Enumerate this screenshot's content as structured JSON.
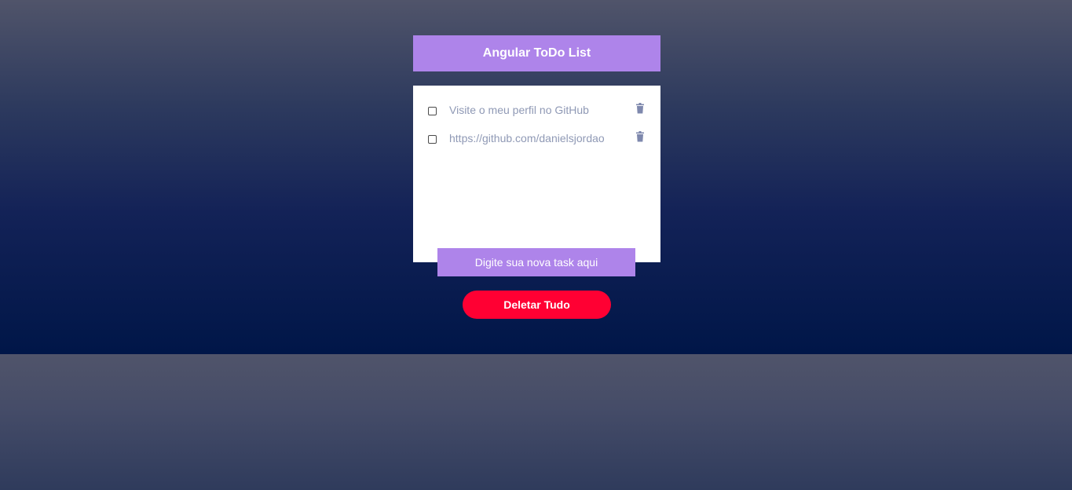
{
  "app": {
    "title": "Angular ToDo List"
  },
  "todos": [
    {
      "text": "Visite o meu perfil no GitHub",
      "checked": false
    },
    {
      "text": "https://github.com/danielsjordao",
      "checked": false
    }
  ],
  "new_task": {
    "placeholder": "Digite sua nova task aqui"
  },
  "actions": {
    "delete_all_label": "Deletar Tudo"
  },
  "icons": {
    "trash": "trash-icon",
    "checkbox": "checkbox-icon"
  },
  "colors": {
    "accent": "#ae84ea",
    "danger": "#ff0033",
    "todo_text": "#8f99b5",
    "trash_icon": "#7e88ad",
    "card_bg": "#ffffff"
  }
}
